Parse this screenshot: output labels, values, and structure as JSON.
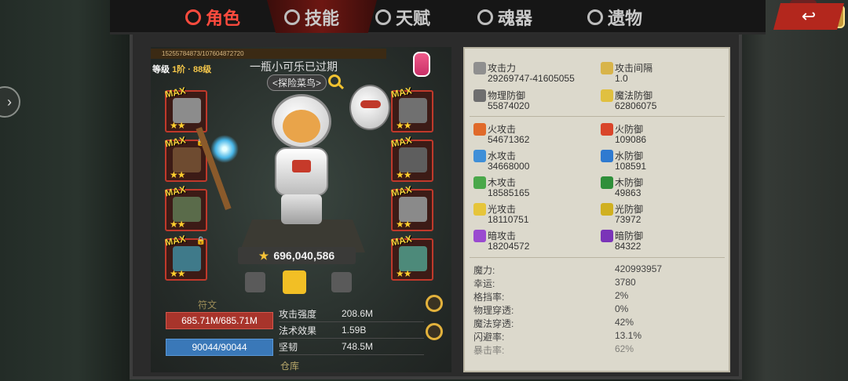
{
  "tabs": [
    {
      "label": "角色",
      "icon": "devil-face-icon",
      "active": true
    },
    {
      "label": "技能",
      "icon": "swirl-icon",
      "active": false
    },
    {
      "label": "天赋",
      "icon": "crest-icon",
      "active": false
    },
    {
      "label": "魂器",
      "icon": "soul-icon",
      "active": false
    },
    {
      "label": "遗物",
      "icon": "relic-icon",
      "active": false
    }
  ],
  "back_label": "↩",
  "player": {
    "id_text": "15255784873/107604872720",
    "level_prefix": "等级",
    "level_value": "1阶 · 88级",
    "name": "一瓶小可乐已过期",
    "title": "<探险菜鸟>",
    "power": "696,040,586"
  },
  "equipment": {
    "max_label": "MAX",
    "left": [
      {
        "slot": "helmet",
        "stars": "★★",
        "locked": false
      },
      {
        "slot": "amulet",
        "stars": "★★",
        "locked": true
      },
      {
        "slot": "staff",
        "stars": "★★",
        "locked": false
      },
      {
        "slot": "feather",
        "stars": "★★",
        "locked": true
      }
    ],
    "right": [
      {
        "slot": "armor",
        "stars": "★★",
        "locked": false
      },
      {
        "slot": "gauntlet",
        "stars": "★★",
        "locked": false
      },
      {
        "slot": "boots",
        "stars": "★★",
        "locked": false
      },
      {
        "slot": "ring",
        "stars": "★★",
        "locked": false
      }
    ]
  },
  "side_label": "符文",
  "hp": "685.71M/685.71M",
  "mp": "90044/90044",
  "mini_stats": [
    {
      "label": "攻击强度",
      "value": "208.6M"
    },
    {
      "label": "法术效果",
      "value": "1.59B"
    },
    {
      "label": "坚韧",
      "value": "748.5M"
    }
  ],
  "storage_label": "仓库",
  "stats_top": [
    {
      "label": "攻击力",
      "value": "29269747-41605055",
      "icon": "sword-icon",
      "color": "#8f8f8f"
    },
    {
      "label": "攻击间隔",
      "value": "1.0",
      "icon": "swift-sword-icon",
      "color": "#d8b44a"
    },
    {
      "label": "物理防御",
      "value": "55874020",
      "icon": "shield-icon",
      "color": "#6e6e6e"
    },
    {
      "label": "魔法防御",
      "value": "62806075",
      "icon": "magic-shield-icon",
      "color": "#e0c040"
    }
  ],
  "stats_element": [
    {
      "label": "火攻击",
      "value": "54671362",
      "icon": "fire-attack-icon",
      "color": "#e06a2a"
    },
    {
      "label": "火防御",
      "value": "109086",
      "icon": "fire-defense-icon",
      "color": "#d9452a"
    },
    {
      "label": "水攻击",
      "value": "34668000",
      "icon": "water-attack-icon",
      "color": "#3f8fd8"
    },
    {
      "label": "水防御",
      "value": "108591",
      "icon": "water-defense-icon",
      "color": "#2f7ad0"
    },
    {
      "label": "木攻击",
      "value": "18585165",
      "icon": "wood-attack-icon",
      "color": "#4aa84a"
    },
    {
      "label": "木防御",
      "value": "49863",
      "icon": "wood-defense-icon",
      "color": "#2f8f3a"
    },
    {
      "label": "光攻击",
      "value": "18110751",
      "icon": "light-attack-icon",
      "color": "#e6c53a"
    },
    {
      "label": "光防御",
      "value": "73972",
      "icon": "light-defense-icon",
      "color": "#d0b020"
    },
    {
      "label": "暗攻击",
      "value": "18204572",
      "icon": "dark-attack-icon",
      "color": "#9a4ad0"
    },
    {
      "label": "暗防御",
      "value": "84322",
      "icon": "dark-defense-icon",
      "color": "#7a34b8"
    }
  ],
  "stats_misc": [
    {
      "label": "魔力:",
      "value": "420993957"
    },
    {
      "label": "幸运:",
      "value": "3780"
    },
    {
      "label": "格挡率:",
      "value": "2%"
    },
    {
      "label": "物理穿透:",
      "value": "0%"
    },
    {
      "label": "魔法穿透:",
      "value": "42%"
    },
    {
      "label": "闪避率:",
      "value": "13.1%"
    },
    {
      "label": "暴击率:",
      "value": "62%"
    }
  ]
}
